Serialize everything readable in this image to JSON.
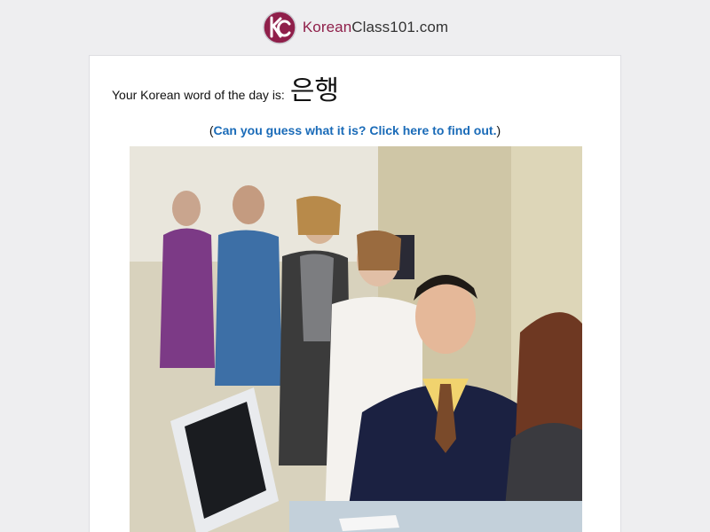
{
  "header": {
    "logo_icon": "koreanclass101-logo-icon",
    "brand_prefix": "Korean",
    "brand_suffix": "Class101.com",
    "brand_color": "#8f1f4a"
  },
  "word_of_day": {
    "label": "Your Korean word of the day is:",
    "word": "은행"
  },
  "guess": {
    "open_paren": "(",
    "link_text": "Can you guess what it is? Click here to find out.",
    "close_paren": ")",
    "link_color": "#1a6bb8"
  },
  "photo": {
    "icon": "bank-queue-photo"
  }
}
